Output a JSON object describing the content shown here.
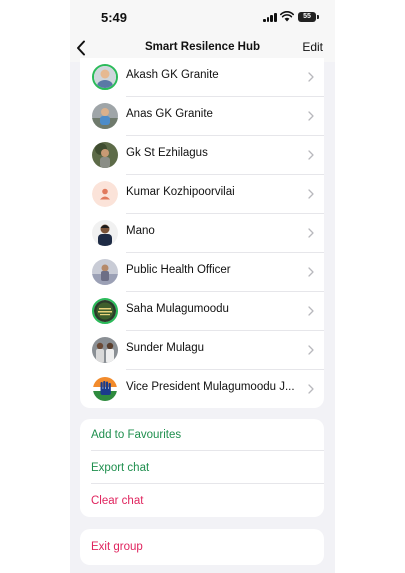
{
  "status": {
    "time": "5:49",
    "battery": "55"
  },
  "nav": {
    "title": "Smart Resilence Hub",
    "edit_label": "Edit"
  },
  "members": [
    {
      "name": "Akash GK Granite",
      "avatar": "photo"
    },
    {
      "name": "Anas GK Granite",
      "avatar": "photo"
    },
    {
      "name": "Gk St Ezhilagus",
      "avatar": "photo"
    },
    {
      "name": "Kumar Kozhipoorvilai",
      "avatar": "default-person"
    },
    {
      "name": "Mano",
      "avatar": "photo"
    },
    {
      "name": "Public Health Officer",
      "avatar": "photo"
    },
    {
      "name": "Saha Mulagumoodu",
      "avatar": "badge-photo"
    },
    {
      "name": "Sunder Mulagu",
      "avatar": "photo"
    },
    {
      "name": "Vice President Mulagumoodu J...",
      "avatar": "hand-logo"
    }
  ],
  "actions": {
    "add_favourites": "Add to Favourites",
    "export_chat": "Export chat",
    "clear_chat": "Clear chat",
    "exit_group": "Exit group"
  },
  "colors": {
    "accent_green": "#1f8f4e",
    "destructive_red": "#e0245e",
    "status_ring": "#2bbb5a"
  }
}
